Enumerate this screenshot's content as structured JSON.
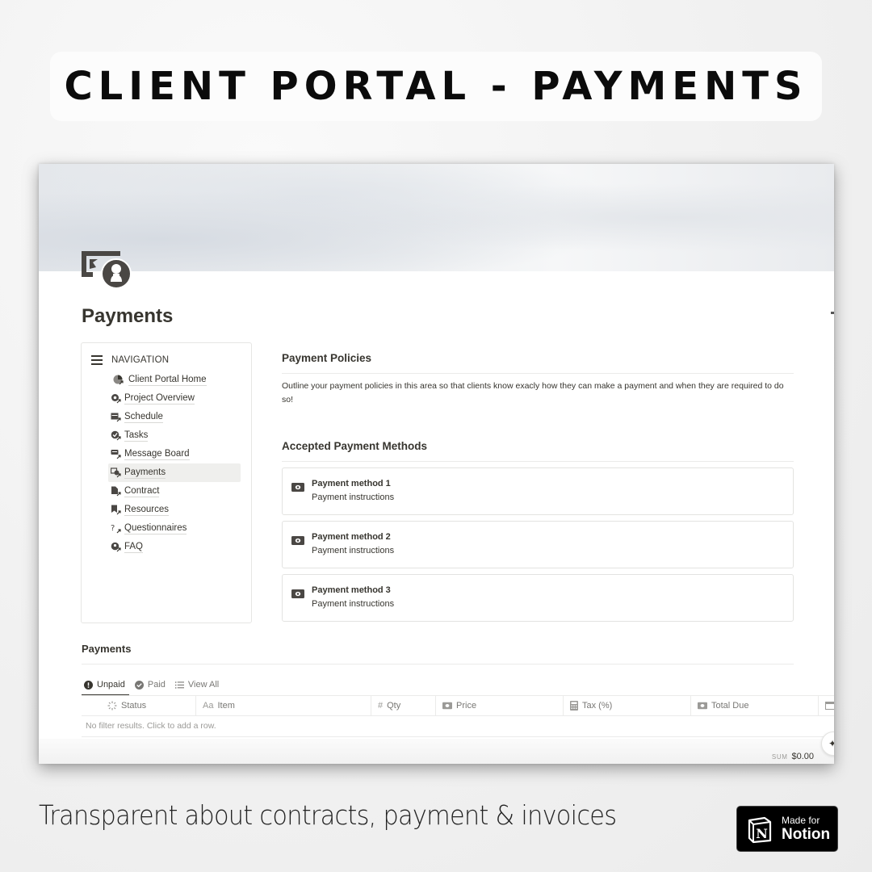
{
  "banner": {
    "title": "CLIENT PORTAL - PAYMENTS"
  },
  "page": {
    "icon": "money-person-icon",
    "title": "Payments"
  },
  "navigation": {
    "title": "NAVIGATION",
    "items": [
      {
        "label": "Client Portal Home",
        "icon": "pie-chart-link-icon",
        "active": false
      },
      {
        "label": "Project Overview",
        "icon": "gear-link-icon",
        "active": false
      },
      {
        "label": "Schedule",
        "icon": "calendar-link-icon",
        "active": false
      },
      {
        "label": "Tasks",
        "icon": "check-link-icon",
        "active": false
      },
      {
        "label": "Message Board",
        "icon": "chat-link-icon",
        "active": false
      },
      {
        "label": "Payments",
        "icon": "money-link-icon",
        "active": true
      },
      {
        "label": "Contract",
        "icon": "document-link-icon",
        "active": false
      },
      {
        "label": "Resources",
        "icon": "bookmark-link-icon",
        "active": false
      },
      {
        "label": "Questionnaires",
        "icon": "question-link-icon",
        "active": false
      },
      {
        "label": "FAQ",
        "icon": "faq-link-icon",
        "active": false
      }
    ]
  },
  "policies": {
    "heading": "Payment Policies",
    "text": "Outline your payment policies in this area so that clients know exacly how they can make a payment and when they are required to do so!"
  },
  "methods": {
    "heading": "Accepted Payment Methods",
    "items": [
      {
        "title": "Payment method 1",
        "subtitle": "Payment instructions",
        "icon": "cash-icon"
      },
      {
        "title": "Payment method 2",
        "subtitle": "Payment instructions",
        "icon": "cash-icon"
      },
      {
        "title": "Payment method 3",
        "subtitle": "Payment instructions",
        "icon": "cash-icon"
      }
    ]
  },
  "database": {
    "title": "Payments",
    "tabs": [
      {
        "label": "Unpaid",
        "icon": "exclamation-circle-icon",
        "active": true
      },
      {
        "label": "Paid",
        "icon": "check-circle-icon",
        "active": false
      },
      {
        "label": "View All",
        "icon": "list-icon",
        "active": false
      }
    ],
    "columns": [
      {
        "label": "Status",
        "icon": "status-spinner-icon"
      },
      {
        "label": "Item",
        "icon": "text-property-icon",
        "icon_text": "Aa"
      },
      {
        "label": "Qty",
        "icon": "number-property-icon",
        "icon_text": "#"
      },
      {
        "label": "Price",
        "icon": "cash-icon"
      },
      {
        "label": "Tax (%)",
        "icon": "calculator-icon"
      },
      {
        "label": "Total Due",
        "icon": "cash-icon"
      },
      {
        "label": "",
        "icon": "date-icon"
      }
    ],
    "empty_message": "No filter results. Click to add a row.",
    "footer": {
      "sum_label": "SUM",
      "sum_value": "$0.00"
    }
  },
  "caption": "Transparent about contracts, payment & invoices",
  "badge": {
    "small": "Made for",
    "big": "Notion"
  },
  "colors": {
    "text": "#37352f",
    "muted": "#787774",
    "border": "#ebebea",
    "active_nav_bg": "#efefed",
    "badge_bg": "#000000"
  }
}
